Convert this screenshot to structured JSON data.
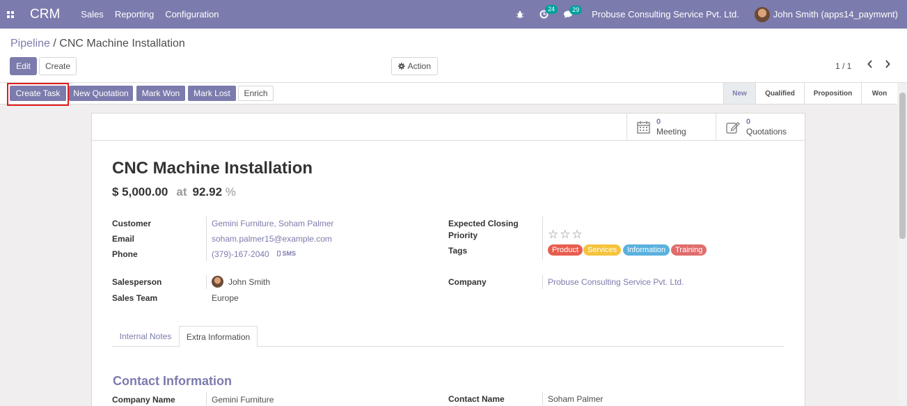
{
  "navbar": {
    "brand": "CRM",
    "menu": [
      "Sales",
      "Reporting",
      "Configuration"
    ],
    "activity_badge": "24",
    "message_badge": "29",
    "company": "Probuse Consulting Service Pvt. Ltd.",
    "user": "John Smith (apps14_paymwnt)",
    "color": "#7c7bad"
  },
  "breadcrumb": {
    "parent": "Pipeline",
    "separator": "/",
    "current": "CNC Machine Installation"
  },
  "control": {
    "edit": "Edit",
    "create": "Create",
    "action": "Action",
    "pager": "1 / 1"
  },
  "statusbar": {
    "buttons": [
      "Create Task",
      "New Quotation",
      "Mark Won",
      "Mark Lost",
      "Enrich"
    ],
    "stages": [
      "New",
      "Qualified",
      "Proposition",
      "Won"
    ],
    "active_stage": "New"
  },
  "smart_buttons": [
    {
      "count": "0",
      "label": "Meeting",
      "icon": "calendar-icon"
    },
    {
      "count": "0",
      "label": "Quotations",
      "icon": "edit-icon"
    }
  ],
  "record": {
    "name": "CNC Machine Installation",
    "revenue": "$ 5,000.00",
    "at": "at",
    "probability": "92.92",
    "pct_sign": "%"
  },
  "fields": {
    "customer_label": "Customer",
    "customer": "Gemini Furniture, Soham Palmer",
    "email_label": "Email",
    "email": "soham.palmer15@example.com",
    "phone_label": "Phone",
    "phone": "(379)-167-2040",
    "sms": "SMS",
    "closing_label": "Expected Closing",
    "priority_label": "Priority",
    "priority_stars": 0,
    "tags_label": "Tags",
    "tags": [
      {
        "name": "Product",
        "color": "#e85d4f"
      },
      {
        "name": "Services",
        "color": "#f5c33b"
      },
      {
        "name": "Information",
        "color": "#5ab1df"
      },
      {
        "name": "Training",
        "color": "#e06c6c"
      }
    ],
    "salesperson_label": "Salesperson",
    "salesperson": "John Smith",
    "team_label": "Sales Team",
    "team": "Europe",
    "company_label": "Company",
    "company": "Probuse Consulting Service Pvt. Ltd."
  },
  "tabs": [
    "Internal Notes",
    "Extra Information"
  ],
  "active_tab": "Extra Information",
  "contact": {
    "title": "Contact Information",
    "company_name_label": "Company Name",
    "company_name": "Gemini Furniture",
    "contact_name_label": "Contact Name",
    "contact_name": "Soham Palmer"
  }
}
